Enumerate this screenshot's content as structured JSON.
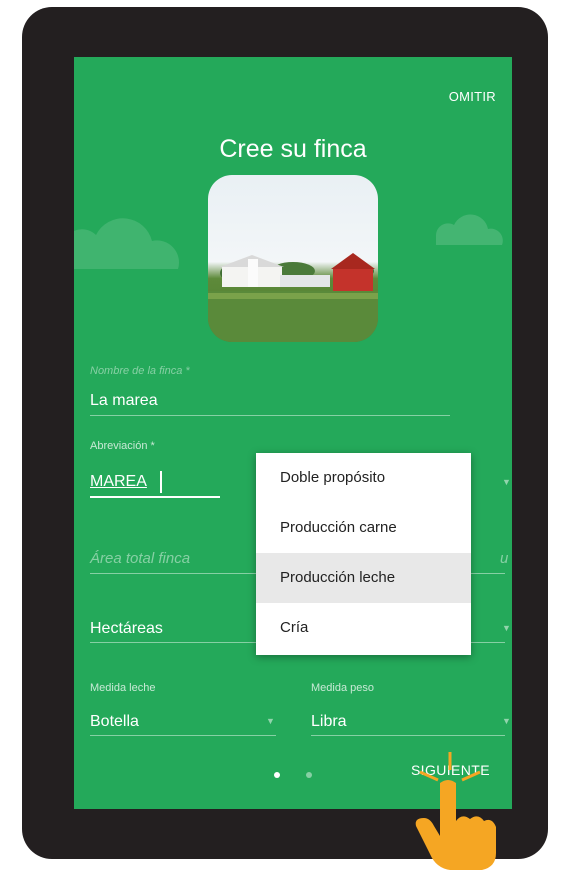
{
  "header": {
    "skip_label": "OMITIR",
    "title": "Cree su finca"
  },
  "form": {
    "farm_name": {
      "label": "Nombre de la finca *",
      "value": "La marea"
    },
    "abbreviation": {
      "label": "Abreviación *",
      "value": "MAREA"
    },
    "area": {
      "placeholder": "Área total finca",
      "unit_partial": "u"
    },
    "area_unit": {
      "value": "Hectáreas"
    },
    "milk_measure": {
      "label": "Medida leche",
      "value": "Botella"
    },
    "weight_measure": {
      "label": "Medida peso",
      "value": "Libra"
    }
  },
  "dropdown": {
    "options": [
      "Doble propósito",
      "Producción carne",
      "Producción leche",
      "Cría"
    ],
    "highlighted_index": 2
  },
  "pager": {
    "current": 1,
    "total": 2
  },
  "footer": {
    "next_label": "SIGUIENTE"
  },
  "icons": {
    "pointer": "hand-pointer-icon",
    "tap": "tap-indicator-icon",
    "dropdown": "chevron-down-icon",
    "cloud": "cloud-icon"
  },
  "colors": {
    "screen_bg": "#24a95a",
    "device": "#231f20",
    "hand": "#f5a623"
  }
}
